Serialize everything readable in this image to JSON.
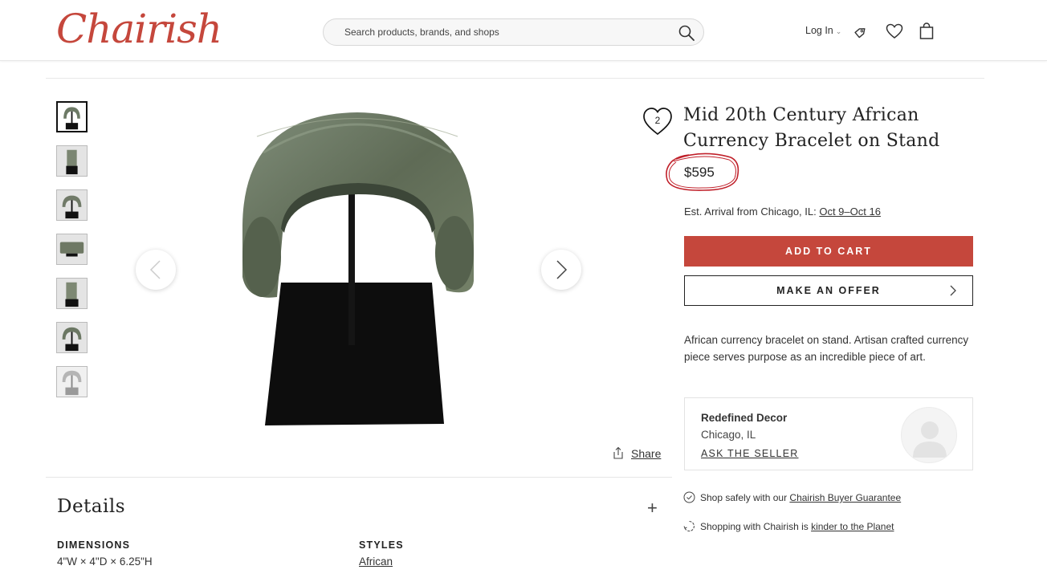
{
  "header": {
    "logo": "Chairish",
    "search_placeholder": "Search products, brands, and shops",
    "login_label": "Log In",
    "icons": [
      "search-icon",
      "tag-icon",
      "heart-icon",
      "bag-icon"
    ]
  },
  "gallery": {
    "thumbnail_count": 7,
    "active_index": 0
  },
  "product": {
    "favorite_count": "2",
    "title": "Mid 20th Century African Currency Bracelet on Stand",
    "price": "$595",
    "arrival_prefix": "Est. Arrival from Chicago, IL: ",
    "arrival_dates": "Oct 9–Oct 16",
    "add_to_cart": "ADD TO CART",
    "make_offer": "MAKE AN OFFER",
    "description": "African currency bracelet on stand. Artisan crafted currency piece serves purpose as an incredible piece of art.",
    "share_label": "Share"
  },
  "seller": {
    "name": "Redefined Decor",
    "location": "Chicago, IL",
    "ask_label": "ASK THE SELLER"
  },
  "trust": {
    "guarantee_prefix": "Shop safely with our ",
    "guarantee_link": "Chairish Buyer Guarantee",
    "planet_prefix": "Shopping with Chairish is ",
    "planet_link": "kinder to the Planet"
  },
  "details": {
    "title": "Details",
    "dimensions_label": "DIMENSIONS",
    "dimensions_value": "4\"W × 4\"D × 6.25\"H",
    "styles_label": "STYLES",
    "styles_value": "African"
  },
  "colors": {
    "brand": "#c5473c",
    "annotation": "#c0202a"
  }
}
